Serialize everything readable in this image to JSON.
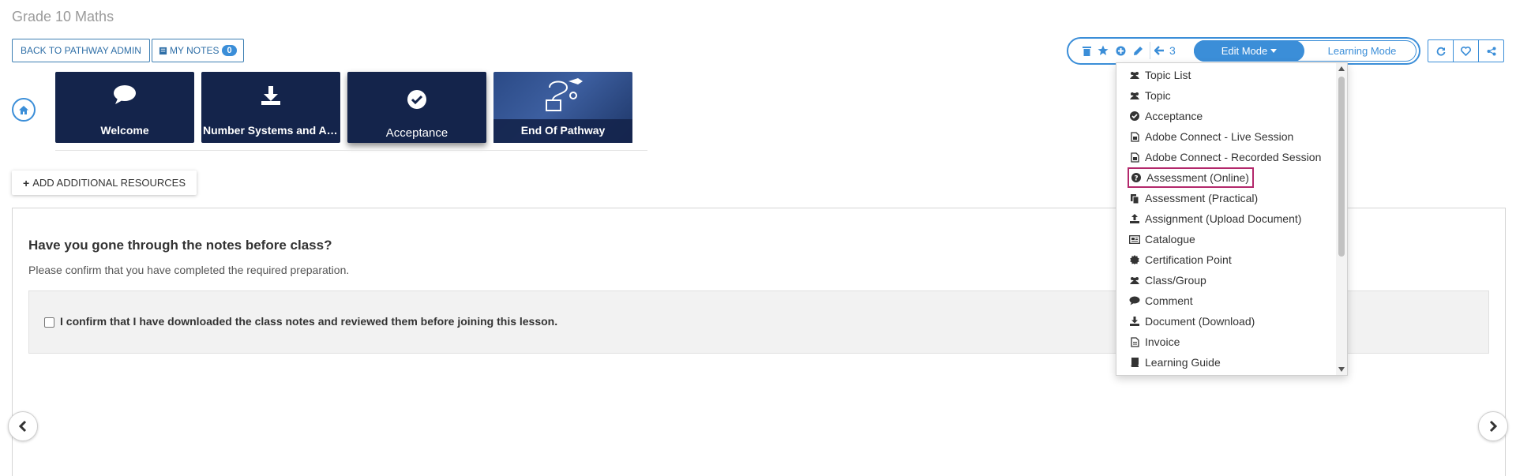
{
  "page": {
    "title": "Grade 10 Maths"
  },
  "header": {
    "back_label": "BACK TO PATHWAY ADMIN",
    "notes_label": "MY NOTES",
    "notes_count": "0"
  },
  "tiles": [
    {
      "label": "Welcome",
      "icon": "comment-icon"
    },
    {
      "label": "Number Systems and Alg...",
      "icon": "download-icon"
    },
    {
      "label": "Acceptance",
      "icon": "check-circle-icon"
    },
    {
      "label": "End Of Pathway",
      "icon": "pathway-graphic"
    }
  ],
  "add_resources_label": "ADD ADDITIONAL RESOURCES",
  "question": {
    "title": "Have you gone through the notes before class?",
    "subtitle": "Please confirm that you have completed the required preparation.",
    "confirm_text": "I confirm that I have downloaded the class notes and reviewed them before joining this lesson."
  },
  "toolbar": {
    "back_count": "3",
    "edit_mode_label": "Edit Mode",
    "learning_mode_label": "Learning Mode",
    "accent": "#3b8ed8"
  },
  "dropdown": {
    "items": [
      {
        "label": "Topic List",
        "icon": "users-icon"
      },
      {
        "label": "Topic",
        "icon": "users-icon"
      },
      {
        "label": "Acceptance",
        "icon": "check-circle-icon"
      },
      {
        "label": "Adobe Connect - Live Session",
        "icon": "file-image-icon"
      },
      {
        "label": "Adobe Connect - Recorded Session",
        "icon": "file-image-icon"
      },
      {
        "label": "Assessment (Online)",
        "icon": "question-circle-icon"
      },
      {
        "label": "Assessment (Practical)",
        "icon": "copy-icon"
      },
      {
        "label": "Assignment (Upload Document)",
        "icon": "upload-icon"
      },
      {
        "label": "Catalogue",
        "icon": "newspaper-icon"
      },
      {
        "label": "Certification Point",
        "icon": "certificate-icon"
      },
      {
        "label": "Class/Group",
        "icon": "users-icon"
      },
      {
        "label": "Comment",
        "icon": "comment-icon"
      },
      {
        "label": "Document (Download)",
        "icon": "download-icon"
      },
      {
        "label": "Invoice",
        "icon": "file-text-icon"
      },
      {
        "label": "Learning Guide",
        "icon": "book-icon"
      }
    ],
    "highlight_color": "#b3286b"
  }
}
